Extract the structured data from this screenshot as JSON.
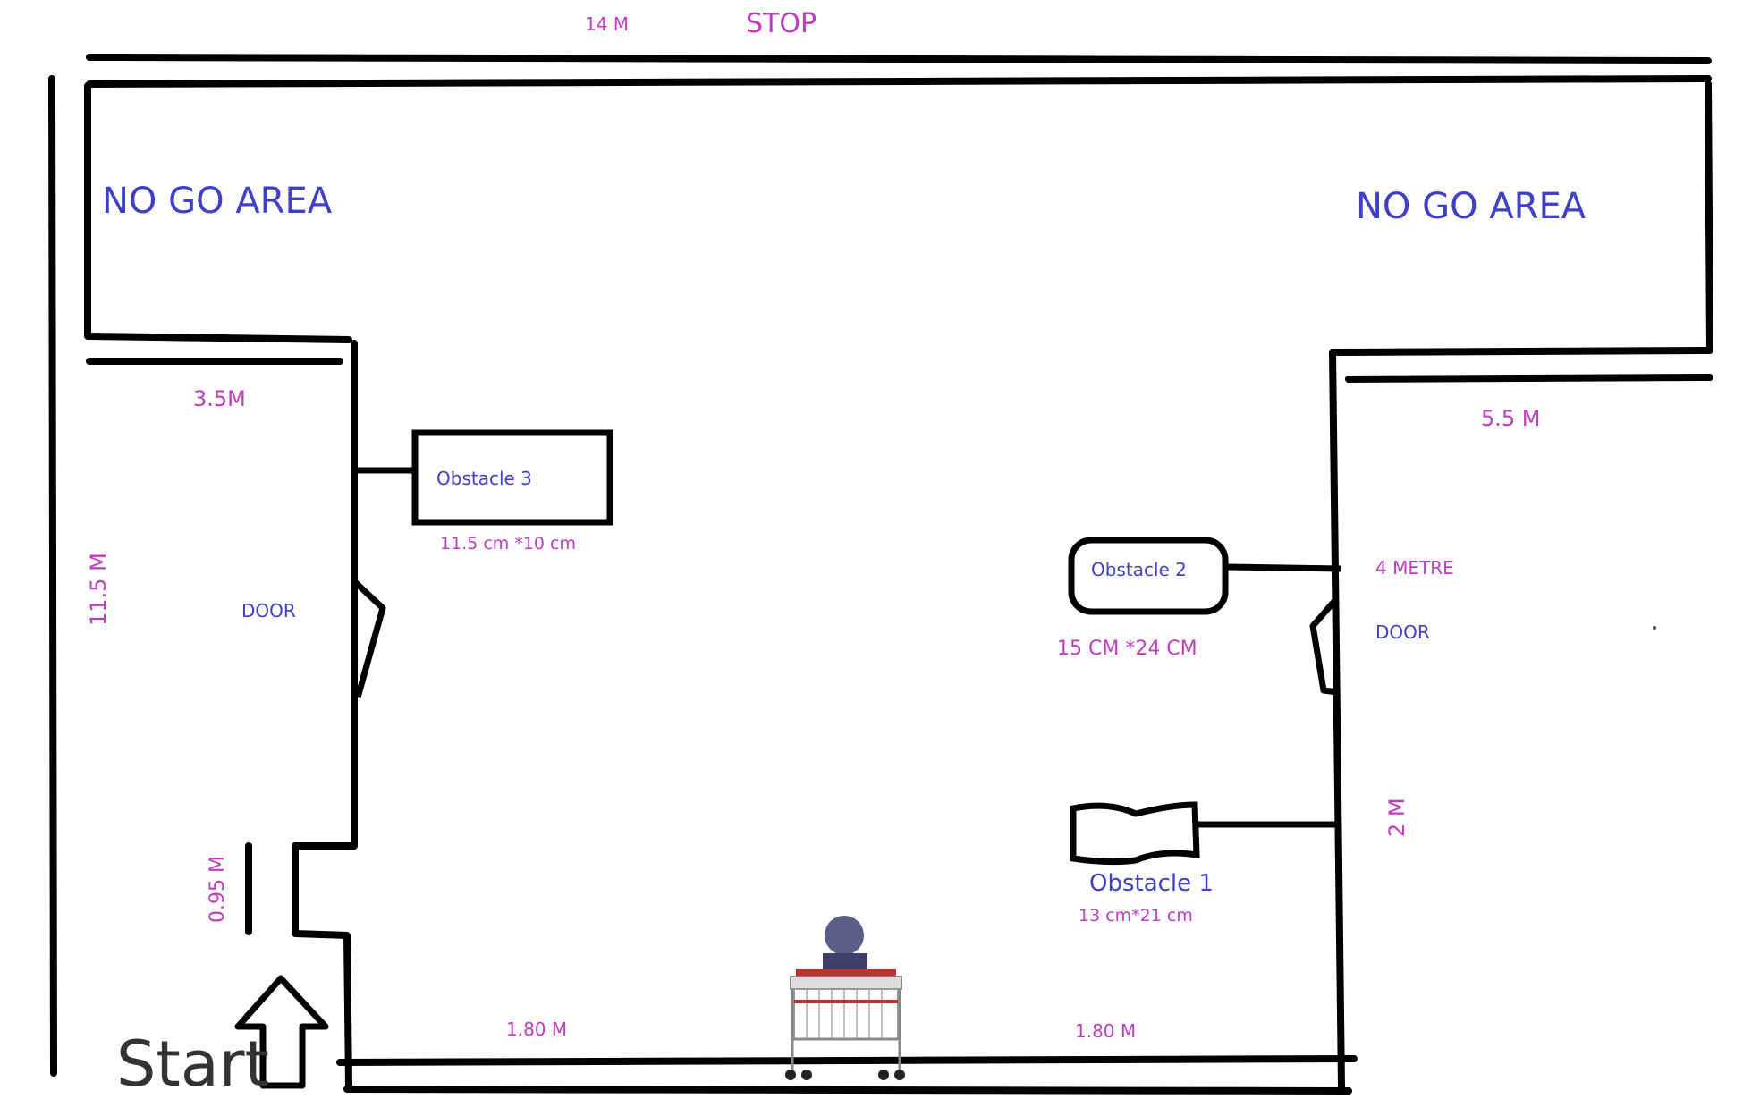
{
  "labels": {
    "top_dimension": "14 M",
    "stop": "STOP",
    "no_go_left": "NO GO AREA",
    "no_go_right": "NO GO AREA",
    "left_top_dim": "3.5M",
    "right_top_dim": "5.5 M",
    "left_height": "11.5 M",
    "door_left": "DOOR",
    "door_right": "DOOR",
    "obstacle3": "Obstacle 3",
    "obstacle3_size": "11.5 cm *10 cm",
    "obstacle2": "Obstacle 2",
    "obstacle2_dist": "4 METRE",
    "obstacle2_size": "15 CM *24 CM",
    "obstacle1": "Obstacle 1",
    "obstacle1_size": "13 cm*21 cm",
    "right_low_dim": "2 M",
    "entrance_width": "0.95 M",
    "bottom_left_dim": "1.80 M",
    "bottom_right_dim": "1.80 M",
    "start": "Start"
  },
  "colors": {
    "dimension": "#c03cc0",
    "label": "#3f3fc8",
    "wall": "#000000",
    "start_text": "#333333"
  },
  "icons": [
    "up-arrow-icon",
    "robot-cart-icon"
  ]
}
